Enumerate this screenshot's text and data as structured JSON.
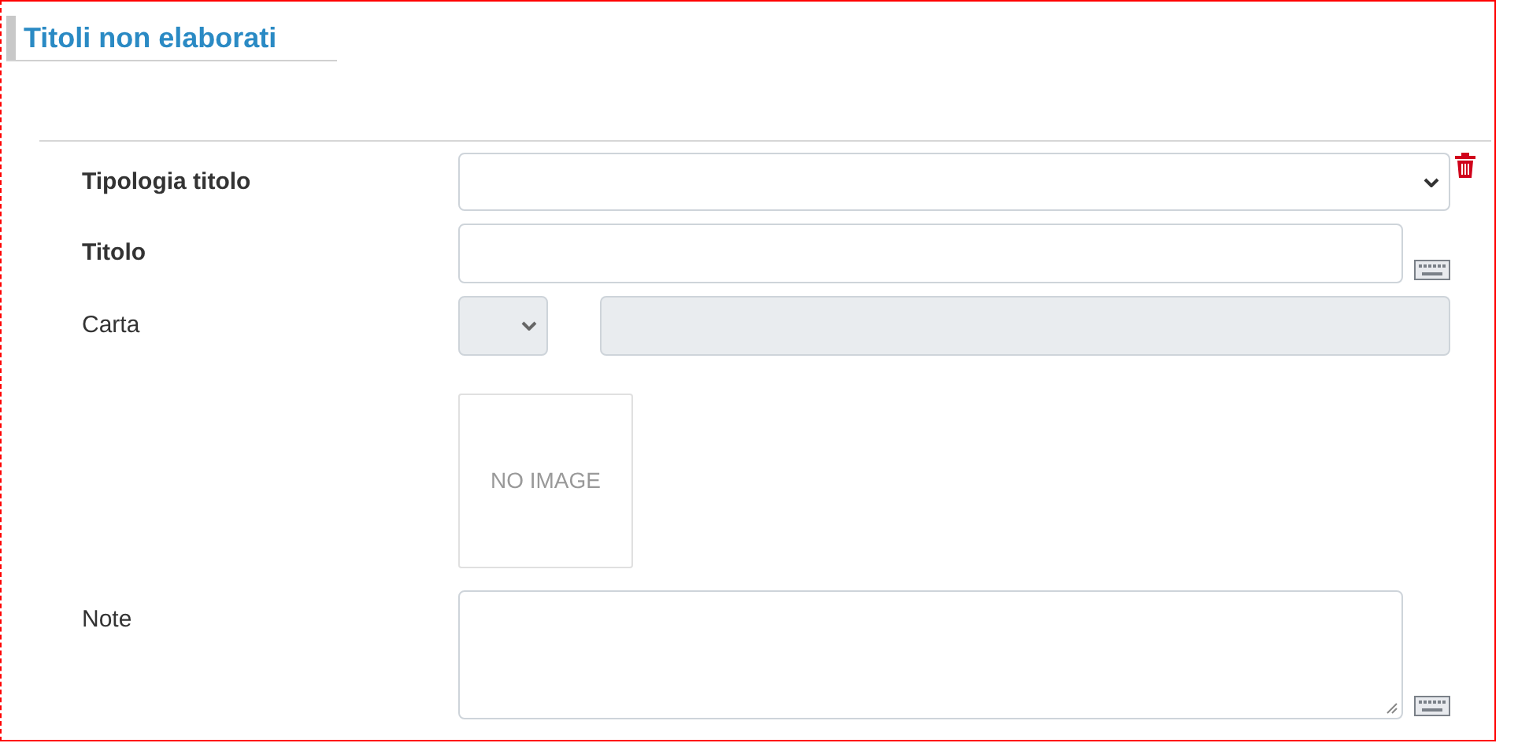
{
  "section": {
    "title": "Titoli non elaborati"
  },
  "fields": [
    {
      "kind": "select",
      "label": "Tipologia titolo",
      "required": true,
      "disabled": false,
      "action": {
        "kind": "delete"
      }
    },
    {
      "kind": "text",
      "label": "Titolo",
      "required": true,
      "disabled": false,
      "action": {
        "kind": "keyboard"
      }
    },
    {
      "kind": "select-text",
      "label": "Carta",
      "required": false,
      "disabled": true
    },
    {
      "kind": "image",
      "image_text": "NO IMAGE"
    },
    {
      "kind": "textarea",
      "label": "Note",
      "required": false,
      "disabled": false,
      "action": {
        "kind": "keyboard"
      }
    }
  ]
}
